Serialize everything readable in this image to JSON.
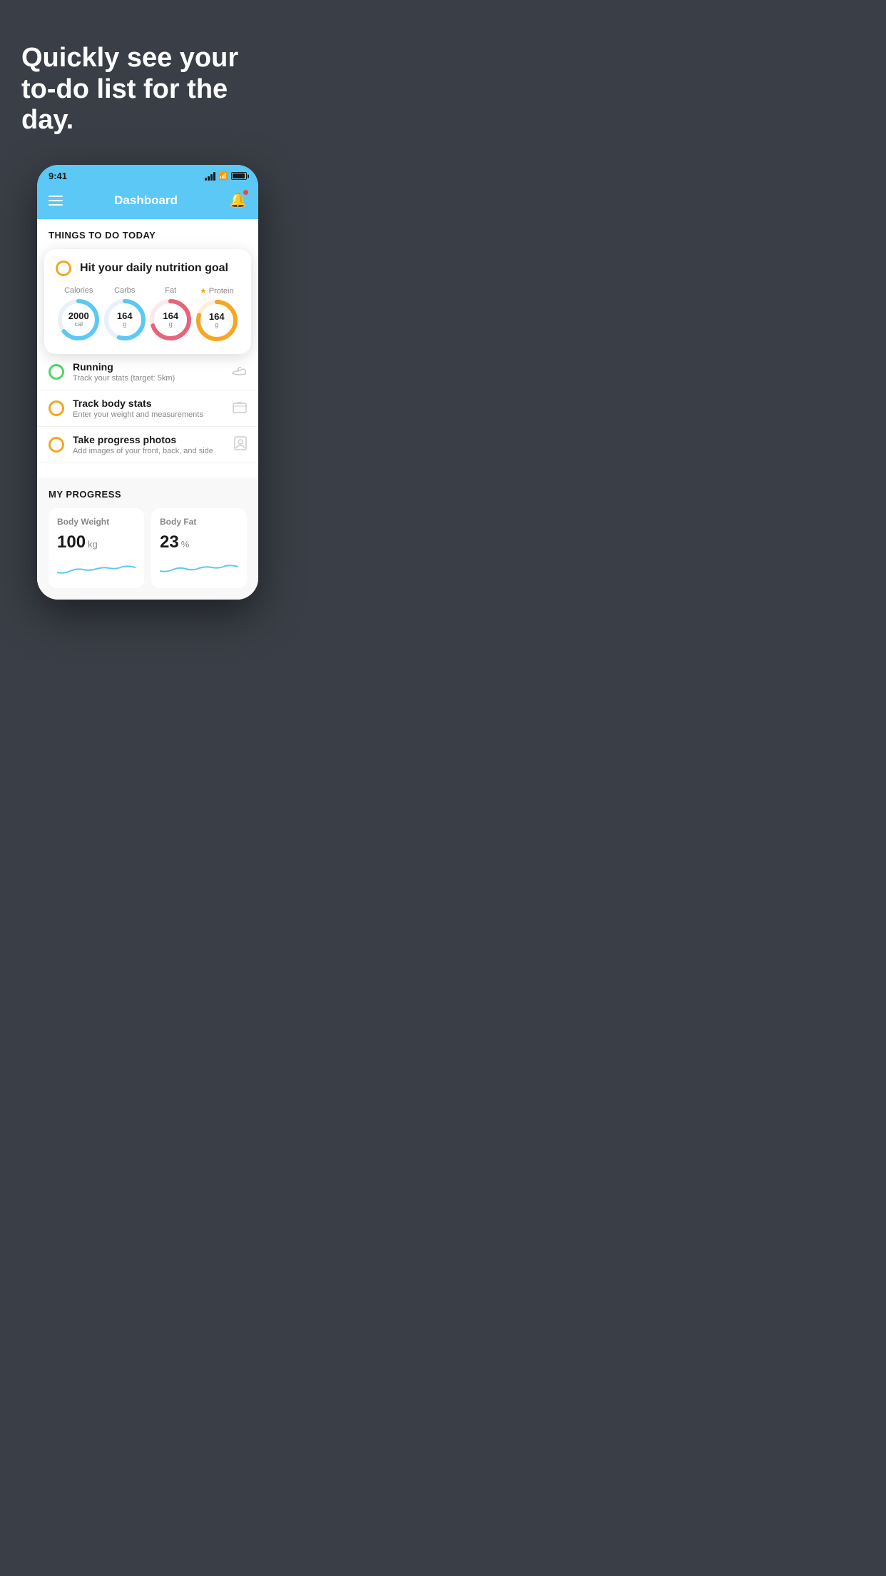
{
  "hero": {
    "title": "Quickly see your to-do list for the day."
  },
  "status_bar": {
    "time": "9:41"
  },
  "nav": {
    "title": "Dashboard"
  },
  "things_section": {
    "title": "THINGS TO DO TODAY"
  },
  "nutrition_card": {
    "title": "Hit your daily nutrition goal",
    "items": [
      {
        "label": "Calories",
        "value": "2000",
        "unit": "cal",
        "color": "#5bc8f5",
        "percent": 65,
        "starred": false
      },
      {
        "label": "Carbs",
        "value": "164",
        "unit": "g",
        "color": "#5bc8f5",
        "percent": 55,
        "starred": false
      },
      {
        "label": "Fat",
        "value": "164",
        "unit": "g",
        "color": "#e8637a",
        "percent": 70,
        "starred": false
      },
      {
        "label": "Protein",
        "value": "164",
        "unit": "g",
        "color": "#f5a623",
        "percent": 80,
        "starred": true
      }
    ]
  },
  "todo_items": [
    {
      "title": "Running",
      "subtitle": "Track your stats (target: 5km)",
      "circle_color": "green",
      "icon": "shoe"
    },
    {
      "title": "Track body stats",
      "subtitle": "Enter your weight and measurements",
      "circle_color": "yellow",
      "icon": "scale"
    },
    {
      "title": "Take progress photos",
      "subtitle": "Add images of your front, back, and side",
      "circle_color": "yellow",
      "icon": "person"
    }
  ],
  "progress_section": {
    "title": "MY PROGRESS",
    "cards": [
      {
        "title": "Body Weight",
        "value": "100",
        "unit": "kg"
      },
      {
        "title": "Body Fat",
        "value": "23",
        "unit": "%"
      }
    ]
  }
}
